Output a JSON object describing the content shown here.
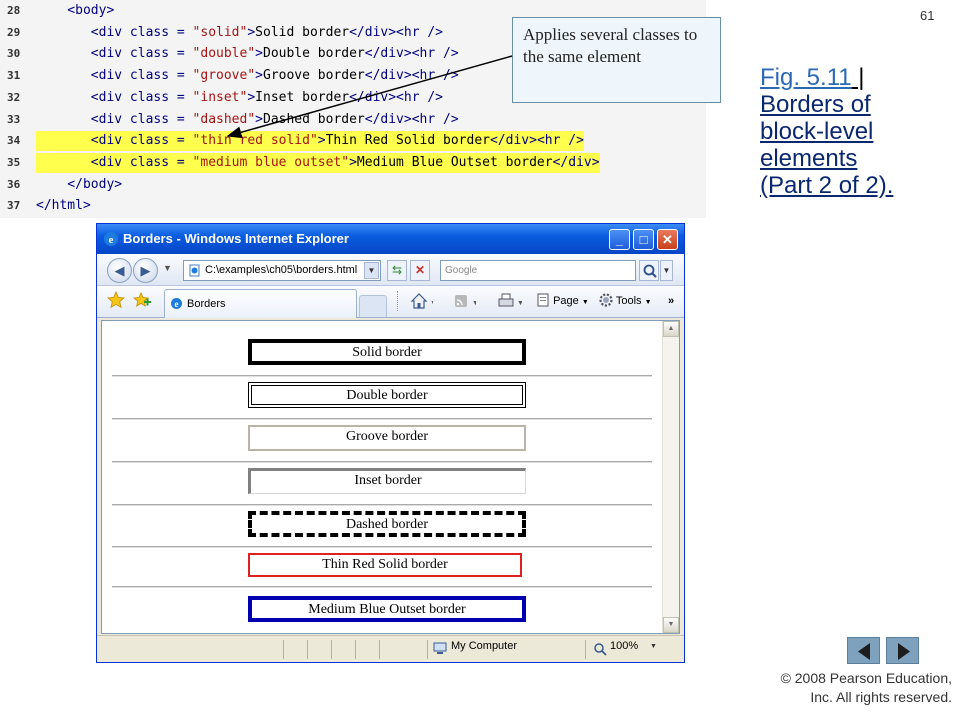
{
  "slide": {
    "number": "61",
    "figure": {
      "link": "Fig. 5.11",
      "separator": " | ",
      "title_lines": [
        "Borders of",
        "block-level",
        "elements",
        "(Part 2 of 2)."
      ]
    },
    "copyright_lines": [
      "© 2008 Pearson Education,",
      "Inc.  All rights reserved."
    ],
    "callout": "Applies several classes to the same element"
  },
  "code": {
    "lines": [
      {
        "num": "28",
        "highlight": false,
        "tokens": [
          [
            "tag",
            "    <body>"
          ]
        ]
      },
      {
        "num": "29",
        "highlight": false,
        "tokens": [
          [
            "tag",
            "       <div class = "
          ],
          [
            "str",
            "\"solid\""
          ],
          [
            "tag",
            ">"
          ],
          [
            "txt",
            "Solid border"
          ],
          [
            "tag",
            "</div><hr />"
          ]
        ]
      },
      {
        "num": "30",
        "highlight": false,
        "tokens": [
          [
            "tag",
            "       <div class = "
          ],
          [
            "str",
            "\"double\""
          ],
          [
            "tag",
            ">"
          ],
          [
            "txt",
            "Double border"
          ],
          [
            "tag",
            "</div><hr />"
          ]
        ]
      },
      {
        "num": "31",
        "highlight": false,
        "tokens": [
          [
            "tag",
            "       <div class = "
          ],
          [
            "str",
            "\"groove\""
          ],
          [
            "tag",
            ">"
          ],
          [
            "txt",
            "Groove border"
          ],
          [
            "tag",
            "</div><hr />"
          ]
        ]
      },
      {
        "num": "32",
        "highlight": false,
        "tokens": [
          [
            "tag",
            "       <div class = "
          ],
          [
            "str",
            "\"inset\""
          ],
          [
            "tag",
            ">"
          ],
          [
            "txt",
            "Inset border"
          ],
          [
            "tag",
            "</div><hr />"
          ]
        ]
      },
      {
        "num": "33",
        "highlight": false,
        "tokens": [
          [
            "tag",
            "       <div class = "
          ],
          [
            "str",
            "\"dashed\""
          ],
          [
            "tag",
            ">"
          ],
          [
            "txt",
            "Dashed border"
          ],
          [
            "tag",
            "</div><hr />"
          ]
        ]
      },
      {
        "num": "34",
        "highlight": true,
        "tokens": [
          [
            "tag",
            "       <div class = "
          ],
          [
            "str",
            "\"thin red solid\""
          ],
          [
            "tag",
            ">"
          ],
          [
            "txt",
            "Thin Red Solid border"
          ],
          [
            "tag",
            "</div><hr />"
          ]
        ]
      },
      {
        "num": "35",
        "highlight": true,
        "tokens": [
          [
            "tag",
            "       <div class = "
          ],
          [
            "str",
            "\"medium blue outset\""
          ],
          [
            "tag",
            ">"
          ],
          [
            "txt",
            "Medium Blue Outset border"
          ],
          [
            "tag",
            "</div>"
          ]
        ]
      },
      {
        "num": "36",
        "highlight": false,
        "tokens": [
          [
            "tag",
            "    </body>"
          ]
        ]
      },
      {
        "num": "37",
        "highlight": false,
        "tokens": [
          [
            "tag",
            "</html>"
          ]
        ]
      }
    ]
  },
  "browser": {
    "title": "Borders - Windows Internet Explorer",
    "address": "C:\\examples\\ch05\\borders.html",
    "search_placeholder": "Google",
    "tab_label": "Borders",
    "toolbar": {
      "page": "Page",
      "tools": "Tools",
      "more": "»"
    },
    "status": {
      "zone": "My Computer",
      "zoom": "100%"
    },
    "boxes": [
      {
        "label": "Solid border",
        "style": "solid"
      },
      {
        "label": "Double border",
        "style": "double"
      },
      {
        "label": "Groove border",
        "style": "groove"
      },
      {
        "label": "Inset border",
        "style": "inset"
      },
      {
        "label": "Dashed border",
        "style": "dashed"
      },
      {
        "label": "Thin Red Solid border",
        "style": "thin-red-solid"
      },
      {
        "label": "Medium Blue Outset border",
        "style": "medium-blue-outset"
      }
    ]
  },
  "colors": {
    "highlight": "#ffff4d",
    "tag": "#000080",
    "string": "#a31515",
    "fig_link": "#2b69b5",
    "title": "#0b2770",
    "red_border": "#e02020",
    "blue_border": "#0000b0"
  },
  "icons": [
    "ie-logo-icon",
    "minimize-icon",
    "maximize-icon",
    "close-icon",
    "back-arrow-icon",
    "forward-arrow-icon",
    "page-icon",
    "refresh-icon",
    "stop-icon",
    "search-icon",
    "favorites-star-icon",
    "add-favorites-icon",
    "home-icon",
    "feeds-icon",
    "print-icon",
    "page-menu-icon",
    "gear-icon",
    "computer-icon",
    "zoom-icon",
    "scroll-up-icon",
    "scroll-down-icon",
    "nav-prev-icon",
    "nav-next-icon"
  ]
}
